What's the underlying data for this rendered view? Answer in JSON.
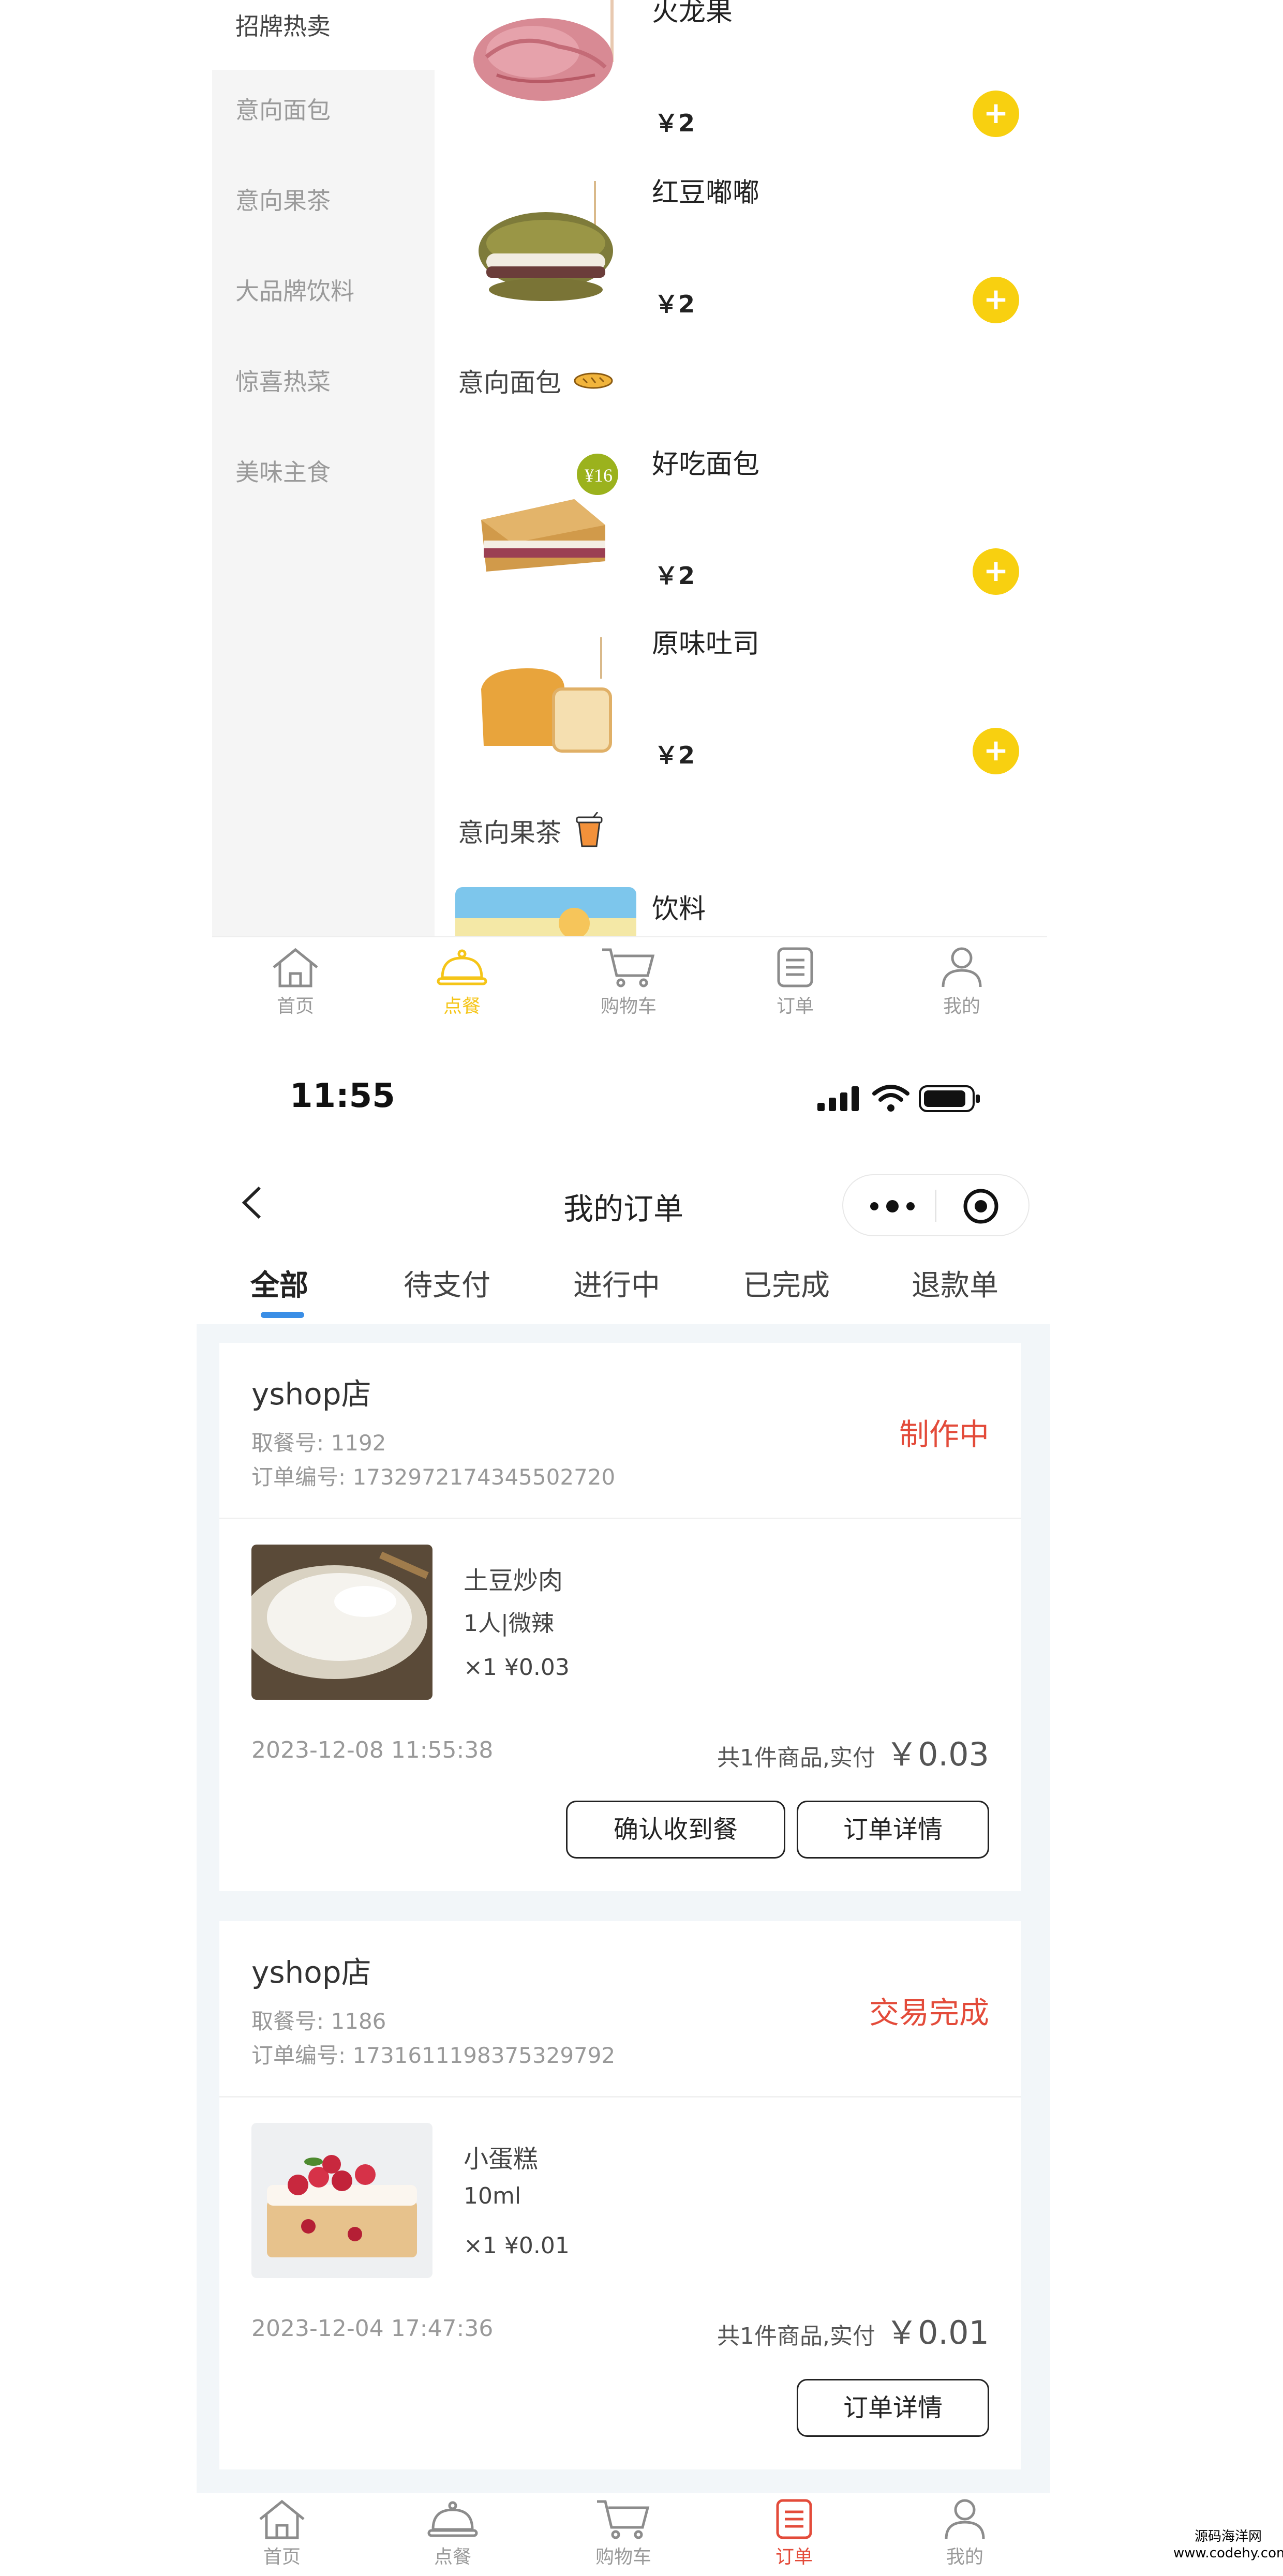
{
  "top_screen": {
    "categories": [
      "招牌热卖",
      "意向面包",
      "意向果茶",
      "大品牌饮料",
      "惊喜热菜",
      "美味主食"
    ],
    "goods": [
      {
        "name": "火龙果",
        "price": "￥2"
      },
      {
        "name": "红豆嘟嘟",
        "price": "￥2"
      },
      {
        "name": "好吃面包",
        "price": "￥2"
      },
      {
        "name": "原味吐司",
        "price": "￥2"
      },
      {
        "name": "饮料"
      }
    ],
    "sections": {
      "bread": "意向面包",
      "tea": "意向果茶"
    },
    "add_symbol": "+",
    "tabbar": [
      "首页",
      "点餐",
      "购物车",
      "订单",
      "我的"
    ],
    "active_tab": "点餐",
    "accent_color": "#f5c518"
  },
  "bottom_screen": {
    "status_bar": {
      "time": "11:55"
    },
    "nav": {
      "title": "我的订单"
    },
    "order_tabs": [
      "全部",
      "待支付",
      "进行中",
      "已完成",
      "退款单"
    ],
    "active_order_tab": "全部",
    "orders": [
      {
        "shop": "yshop店",
        "pickup_label": "取餐号:",
        "pickup": "1192",
        "order_no_label": "订单编号:",
        "order_no": "1732972174345502720",
        "status": "制作中",
        "item_name": "土豆炒肉",
        "item_spec": "1人|微辣",
        "item_qty": "×1 ¥0.03",
        "time": "2023-12-08 11:55:38",
        "summary": "共1件商品,实付",
        "total": "￥0.03",
        "buttons": [
          "确认收到餐",
          "订单详情"
        ]
      },
      {
        "shop": "yshop店",
        "pickup_label": "取餐号:",
        "pickup": "1186",
        "order_no_label": "订单编号:",
        "order_no": "1731611198375329792",
        "status": "交易完成",
        "item_name": "小蛋糕",
        "item_spec": "10ml",
        "item_qty": "×1 ¥0.01",
        "time": "2023-12-04 17:47:36",
        "summary": "共1件商品,实付",
        "total": "￥0.01",
        "buttons": [
          "订单详情"
        ]
      }
    ],
    "tabbar": [
      "首页",
      "点餐",
      "购物车",
      "订单",
      "我的"
    ],
    "active_tab": "订单",
    "status_color": "#e34b3a",
    "active_tab_color": "#e34b3a"
  },
  "watermark": {
    "line1": "源码海洋网",
    "line2": "www.codehy.com"
  }
}
